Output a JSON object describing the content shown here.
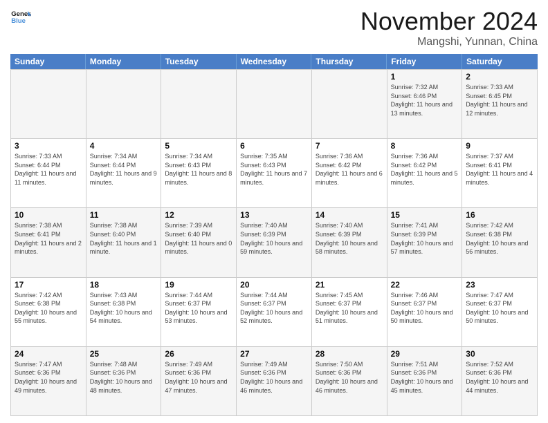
{
  "header": {
    "logo_general": "General",
    "logo_blue": "Blue",
    "month_title": "November 2024",
    "location": "Mangshi, Yunnan, China"
  },
  "days_of_week": [
    "Sunday",
    "Monday",
    "Tuesday",
    "Wednesday",
    "Thursday",
    "Friday",
    "Saturday"
  ],
  "rows": [
    [
      {
        "day": "",
        "info": ""
      },
      {
        "day": "",
        "info": ""
      },
      {
        "day": "",
        "info": ""
      },
      {
        "day": "",
        "info": ""
      },
      {
        "day": "",
        "info": ""
      },
      {
        "day": "1",
        "info": "Sunrise: 7:32 AM\nSunset: 6:46 PM\nDaylight: 11 hours and 13 minutes."
      },
      {
        "day": "2",
        "info": "Sunrise: 7:33 AM\nSunset: 6:45 PM\nDaylight: 11 hours and 12 minutes."
      }
    ],
    [
      {
        "day": "3",
        "info": "Sunrise: 7:33 AM\nSunset: 6:44 PM\nDaylight: 11 hours and 11 minutes."
      },
      {
        "day": "4",
        "info": "Sunrise: 7:34 AM\nSunset: 6:44 PM\nDaylight: 11 hours and 9 minutes."
      },
      {
        "day": "5",
        "info": "Sunrise: 7:34 AM\nSunset: 6:43 PM\nDaylight: 11 hours and 8 minutes."
      },
      {
        "day": "6",
        "info": "Sunrise: 7:35 AM\nSunset: 6:43 PM\nDaylight: 11 hours and 7 minutes."
      },
      {
        "day": "7",
        "info": "Sunrise: 7:36 AM\nSunset: 6:42 PM\nDaylight: 11 hours and 6 minutes."
      },
      {
        "day": "8",
        "info": "Sunrise: 7:36 AM\nSunset: 6:42 PM\nDaylight: 11 hours and 5 minutes."
      },
      {
        "day": "9",
        "info": "Sunrise: 7:37 AM\nSunset: 6:41 PM\nDaylight: 11 hours and 4 minutes."
      }
    ],
    [
      {
        "day": "10",
        "info": "Sunrise: 7:38 AM\nSunset: 6:41 PM\nDaylight: 11 hours and 2 minutes."
      },
      {
        "day": "11",
        "info": "Sunrise: 7:38 AM\nSunset: 6:40 PM\nDaylight: 11 hours and 1 minute."
      },
      {
        "day": "12",
        "info": "Sunrise: 7:39 AM\nSunset: 6:40 PM\nDaylight: 11 hours and 0 minutes."
      },
      {
        "day": "13",
        "info": "Sunrise: 7:40 AM\nSunset: 6:39 PM\nDaylight: 10 hours and 59 minutes."
      },
      {
        "day": "14",
        "info": "Sunrise: 7:40 AM\nSunset: 6:39 PM\nDaylight: 10 hours and 58 minutes."
      },
      {
        "day": "15",
        "info": "Sunrise: 7:41 AM\nSunset: 6:39 PM\nDaylight: 10 hours and 57 minutes."
      },
      {
        "day": "16",
        "info": "Sunrise: 7:42 AM\nSunset: 6:38 PM\nDaylight: 10 hours and 56 minutes."
      }
    ],
    [
      {
        "day": "17",
        "info": "Sunrise: 7:42 AM\nSunset: 6:38 PM\nDaylight: 10 hours and 55 minutes."
      },
      {
        "day": "18",
        "info": "Sunrise: 7:43 AM\nSunset: 6:38 PM\nDaylight: 10 hours and 54 minutes."
      },
      {
        "day": "19",
        "info": "Sunrise: 7:44 AM\nSunset: 6:37 PM\nDaylight: 10 hours and 53 minutes."
      },
      {
        "day": "20",
        "info": "Sunrise: 7:44 AM\nSunset: 6:37 PM\nDaylight: 10 hours and 52 minutes."
      },
      {
        "day": "21",
        "info": "Sunrise: 7:45 AM\nSunset: 6:37 PM\nDaylight: 10 hours and 51 minutes."
      },
      {
        "day": "22",
        "info": "Sunrise: 7:46 AM\nSunset: 6:37 PM\nDaylight: 10 hours and 50 minutes."
      },
      {
        "day": "23",
        "info": "Sunrise: 7:47 AM\nSunset: 6:37 PM\nDaylight: 10 hours and 50 minutes."
      }
    ],
    [
      {
        "day": "24",
        "info": "Sunrise: 7:47 AM\nSunset: 6:36 PM\nDaylight: 10 hours and 49 minutes."
      },
      {
        "day": "25",
        "info": "Sunrise: 7:48 AM\nSunset: 6:36 PM\nDaylight: 10 hours and 48 minutes."
      },
      {
        "day": "26",
        "info": "Sunrise: 7:49 AM\nSunset: 6:36 PM\nDaylight: 10 hours and 47 minutes."
      },
      {
        "day": "27",
        "info": "Sunrise: 7:49 AM\nSunset: 6:36 PM\nDaylight: 10 hours and 46 minutes."
      },
      {
        "day": "28",
        "info": "Sunrise: 7:50 AM\nSunset: 6:36 PM\nDaylight: 10 hours and 46 minutes."
      },
      {
        "day": "29",
        "info": "Sunrise: 7:51 AM\nSunset: 6:36 PM\nDaylight: 10 hours and 45 minutes."
      },
      {
        "day": "30",
        "info": "Sunrise: 7:52 AM\nSunset: 6:36 PM\nDaylight: 10 hours and 44 minutes."
      }
    ]
  ],
  "alt_rows": [
    0,
    2,
    4
  ]
}
